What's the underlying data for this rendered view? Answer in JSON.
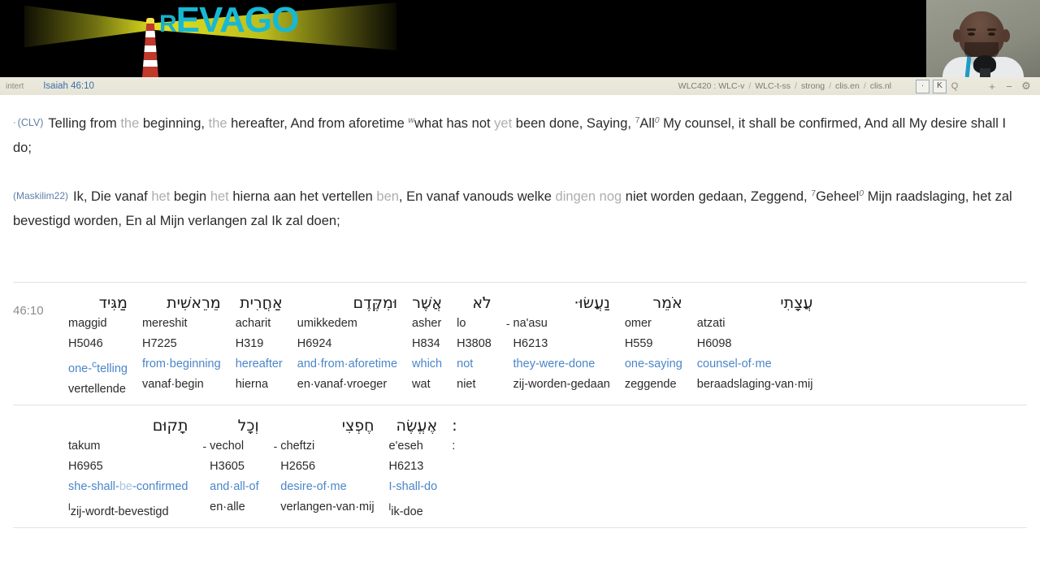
{
  "banner": {
    "logo_text": "REVAGO",
    "logo_first_letter": "R",
    "logo_rest": "EVAGO",
    "logo_color": "#17b8d4",
    "beam_color": "#dedd1e",
    "background": "#000000"
  },
  "webcam": {
    "label": "webcam-thumbnail"
  },
  "toolbar": {
    "mode_label": "intert",
    "reference": "Isaiah 46:10",
    "resources": [
      "WLC420 : WLC-v",
      "WLC-t-ss",
      "strong",
      "clis.en",
      "clis.nl"
    ],
    "separator": "/",
    "btn_dot": "·",
    "btn_k": "K",
    "btn_q": "Q",
    "btn_plus": "+",
    "btn_minus": "−",
    "btn_gear": "⚙",
    "accent": "#3f6fa8"
  },
  "verses": [
    {
      "id": "clv",
      "bullet": "·",
      "tag": "(CLV)",
      "parts": [
        {
          "t": "Telling from ",
          "s": "normal"
        },
        {
          "t": "the",
          "s": "light"
        },
        {
          "t": " beginning, ",
          "s": "normal"
        },
        {
          "t": "the",
          "s": "light"
        },
        {
          "t": " hereafter, And from aforetime ",
          "s": "normal"
        },
        {
          "t": "w",
          "s": "sup-italic"
        },
        {
          "t": "what has not ",
          "s": "normal"
        },
        {
          "t": "yet",
          "s": "light"
        },
        {
          "t": " been done, Saying, ",
          "s": "normal"
        },
        {
          "t": "7",
          "s": "sup"
        },
        {
          "t": "All",
          "s": "normal"
        },
        {
          "t": "0",
          "s": "sup-italic"
        },
        {
          "t": " My counsel, it shall be confirmed, And all My desire shall I do;",
          "s": "normal"
        }
      ]
    },
    {
      "id": "maskilim22",
      "bullet": "",
      "tag": "(Maskilim22)",
      "parts": [
        {
          "t": "Ik, Die ",
          "s": "normal"
        },
        {
          "t": "vanaf",
          "s": "bold-normal"
        },
        {
          "t": " ",
          "s": "normal"
        },
        {
          "t": "het",
          "s": "light"
        },
        {
          "t": " begin ",
          "s": "normal"
        },
        {
          "t": "het",
          "s": "light"
        },
        {
          "t": " hierna aan het vertellen ",
          "s": "normal"
        },
        {
          "t": "ben",
          "s": "light"
        },
        {
          "t": ", En vanaf vanouds welke ",
          "s": "normal"
        },
        {
          "t": "dingen nog",
          "s": "light"
        },
        {
          "t": " niet worden gedaan, Zeggend, ",
          "s": "normal"
        },
        {
          "t": "7",
          "s": "sup"
        },
        {
          "t": "Geheel",
          "s": "normal"
        },
        {
          "t": "0",
          "s": "sup-italic"
        },
        {
          "t": " Mijn raadslaging, het zal bevestigd worden, En al Mijn verlangen zal Ik zal doen;",
          "s": "normal"
        }
      ]
    }
  ],
  "interlinear": {
    "reference": "46:10",
    "rows": [
      {
        "cells": [
          {
            "prefix": "",
            "hebrew": "מַגִּיד",
            "translit": "maggid",
            "strong": "H5046",
            "en": "one-",
            "en_mark": "c",
            "en_rest": "telling",
            "nl": "vertellende"
          },
          {
            "prefix": "",
            "hebrew": "מֵרֵאשִׁית",
            "translit": "mereshit",
            "strong": "H7225",
            "en": "from·beginning",
            "nl": "vanaf·begin"
          },
          {
            "prefix": "",
            "hebrew": "אַחֲרִית",
            "translit": "acharit",
            "strong": "H319",
            "en": "hereafter",
            "nl": "hierna"
          },
          {
            "prefix": "",
            "hebrew": "וּמִקֶּדֶם",
            "translit": "umikkedem",
            "strong": "H6924",
            "en": "and·from·aforetime",
            "nl": "en·vanaf·vroeger"
          },
          {
            "prefix": "",
            "hebrew": "אֲשֶׁר",
            "translit": "asher",
            "strong": "H834",
            "en": "which",
            "nl": "wat"
          },
          {
            "prefix": "",
            "hebrew": "לֹא",
            "translit": "lo",
            "strong": "H3808",
            "en": "not",
            "nl": "niet"
          },
          {
            "prefix": "-",
            "hebrew": "נַעֲשׂוּ·",
            "translit": "na'asu",
            "strong": "H6213",
            "en": "they-were-done",
            "nl": "zij-worden-gedaan"
          },
          {
            "prefix": "",
            "hebrew": "אֹמֵר",
            "translit": "omer",
            "strong": "H559",
            "en": "one-saying",
            "nl": "zeggende"
          },
          {
            "prefix": "",
            "hebrew": "עֲצָתִי",
            "translit": "atzati",
            "strong": "H6098",
            "en": "counsel-of·me",
            "nl": "beraadslaging-van·mij"
          }
        ]
      },
      {
        "cells": [
          {
            "prefix": "",
            "hebrew": "תָקוּם",
            "translit": "takum",
            "strong": "H6965",
            "en": "she-shall-",
            "en_dim": "be",
            "en_rest": "-confirmed",
            "nl": "zij-wordt-bevestigd",
            "nl_mark": "l"
          },
          {
            "prefix": "-",
            "hebrew": "וְכָל",
            "translit": "vechol",
            "strong": "H3605",
            "en": "and·all-of",
            "nl": "en·alle"
          },
          {
            "prefix": "-",
            "hebrew": "חֶפְצִי",
            "translit": "cheftzi",
            "strong": "H2656",
            "en": "desire-of·me",
            "nl": "verlangen-van·mij"
          },
          {
            "prefix": "",
            "hebrew": "אֶעֱשֶׂה",
            "translit": "e'eseh",
            "strong": "H6213",
            "en": "I-shall-do",
            "nl": "ik-doe",
            "nl_mark": "l"
          },
          {
            "prefix": "",
            "hebrew": ":",
            "translit": ":",
            "strong": "",
            "en": "",
            "nl": ""
          }
        ]
      }
    ]
  }
}
